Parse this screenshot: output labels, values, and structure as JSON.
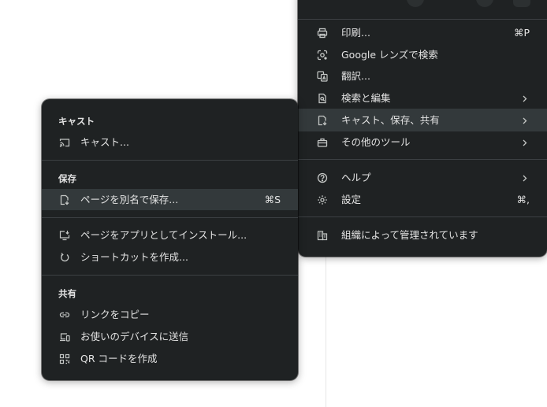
{
  "main_menu": {
    "items": [
      {
        "label": "印刷...",
        "shortcut": "⌘P",
        "icon": "print-icon"
      },
      {
        "label": "Google レンズで検索",
        "icon": "lens-icon"
      },
      {
        "label": "翻訳...",
        "icon": "translate-icon"
      },
      {
        "label": "検索と編集",
        "icon": "find-edit-icon",
        "submenu": true
      },
      {
        "label": "キャスト、保存、共有",
        "icon": "cast-save-share-icon",
        "submenu": true,
        "highlighted": true
      },
      {
        "label": "その他のツール",
        "icon": "toolbox-icon",
        "submenu": true
      },
      {
        "label": "ヘルプ",
        "icon": "help-icon",
        "submenu": true
      },
      {
        "label": "設定",
        "shortcut": "⌘,",
        "icon": "gear-icon"
      },
      {
        "label": "組織によって管理されています",
        "icon": "building-icon"
      }
    ]
  },
  "sub_menu": {
    "sections": {
      "cast": "キャスト",
      "save": "保存",
      "share": "共有"
    },
    "items": [
      {
        "label": "キャスト...",
        "icon": "cast-icon"
      },
      {
        "label": "ページを別名で保存...",
        "shortcut": "⌘S",
        "icon": "save-page-icon",
        "highlighted": true
      },
      {
        "label": "ページをアプリとしてインストール...",
        "icon": "install-app-icon"
      },
      {
        "label": "ショートカットを作成...",
        "icon": "shortcut-icon"
      },
      {
        "label": "リンクをコピー",
        "icon": "link-icon"
      },
      {
        "label": "お使いのデバイスに送信",
        "icon": "devices-icon"
      },
      {
        "label": "QR コードを作成",
        "icon": "qr-code-icon"
      }
    ]
  },
  "colors": {
    "menu_bg": "#1f2223",
    "highlight": "#33393b",
    "text": "#e3e3e3",
    "separator": "#3c4043"
  }
}
